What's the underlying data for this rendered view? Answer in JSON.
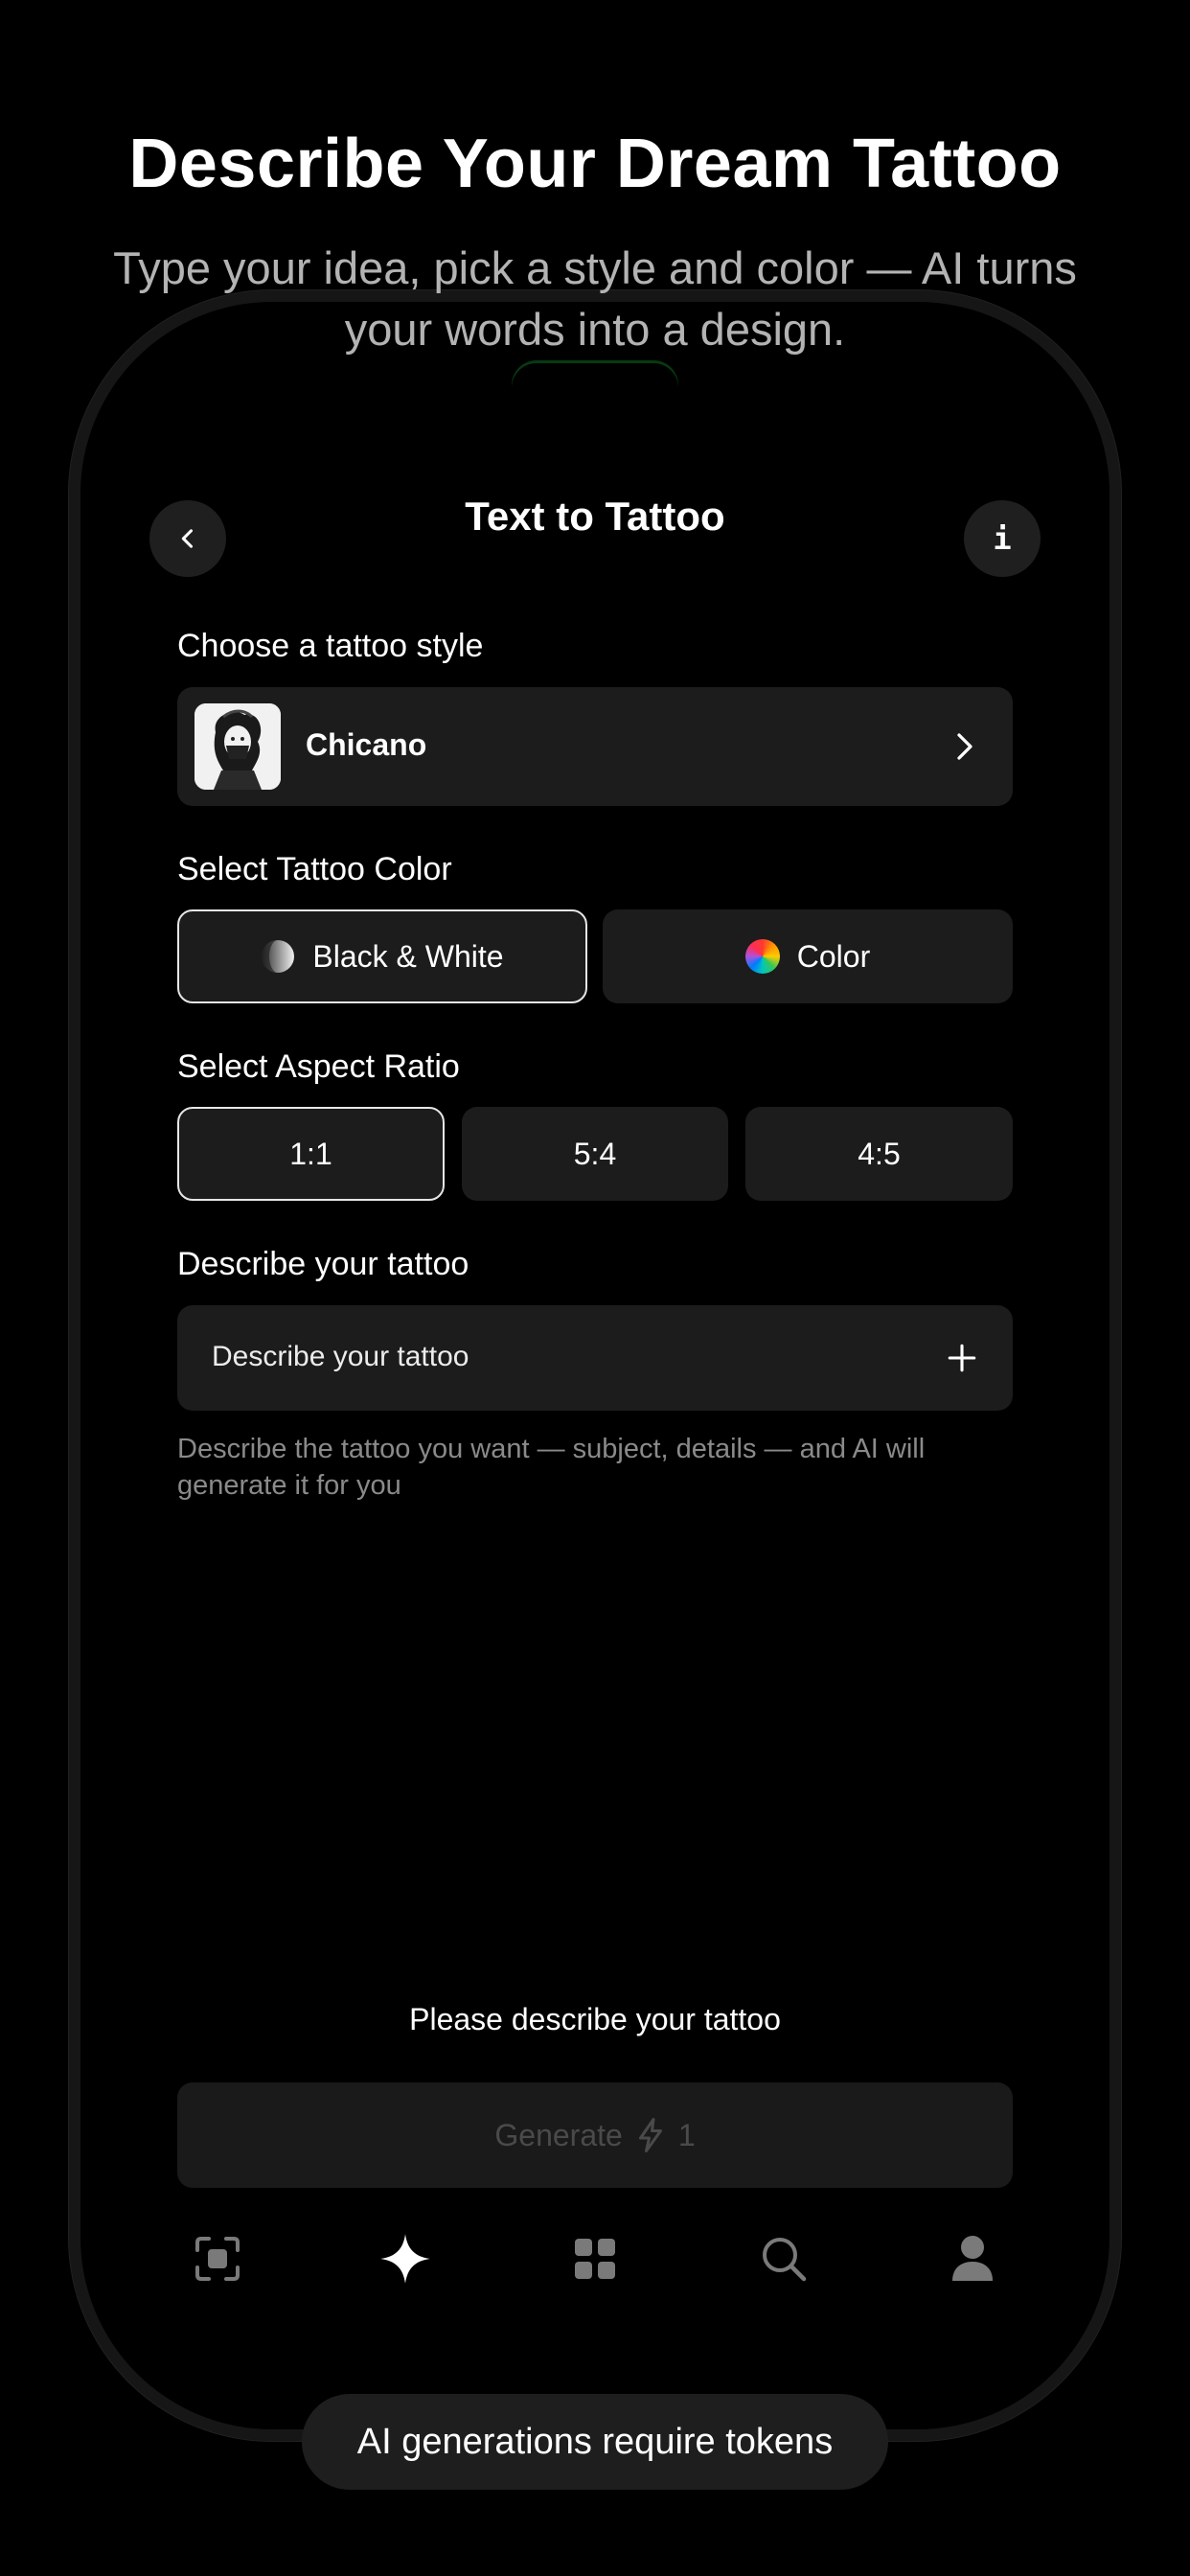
{
  "promo": {
    "headline": "Describe Your Dream Tattoo",
    "subline": "Type your idea, pick a style and color — AI turns your words into a design."
  },
  "header": {
    "title": "Text to Tattoo",
    "back_icon": "chevron-left-icon",
    "info_label": "i"
  },
  "style_section": {
    "label": "Choose a tattoo style",
    "selected_style": "Chicano",
    "thumbnail_icon": "chicano-woman-portrait",
    "chevron_icon": "chevron-right-icon"
  },
  "color_section": {
    "label": "Select Tattoo Color",
    "options": [
      {
        "label": "Black & White",
        "icon": "grayscale-circle-icon",
        "selected": true
      },
      {
        "label": "Color",
        "icon": "rainbow-circle-icon",
        "selected": false
      }
    ]
  },
  "aspect_section": {
    "label": "Select Aspect Ratio",
    "options": [
      {
        "label": "1:1",
        "selected": true
      },
      {
        "label": "5:4",
        "selected": false
      },
      {
        "label": "4:5",
        "selected": false
      }
    ]
  },
  "describe_section": {
    "label": "Describe your tattoo",
    "placeholder": "Describe your tattoo",
    "add_icon": "plus-icon",
    "hint": "Describe the tattoo you want — subject, details — and AI will generate it for you"
  },
  "status_message": "Please describe your tattoo",
  "generate": {
    "label": "Generate",
    "cost": "1",
    "icon": "lightning-icon",
    "enabled": false
  },
  "tab_bar": [
    {
      "name": "scan",
      "icon": "scan-icon",
      "active": false
    },
    {
      "name": "create",
      "icon": "sparkle-icon",
      "active": true
    },
    {
      "name": "gallery",
      "icon": "grid-icon",
      "active": false
    },
    {
      "name": "search",
      "icon": "search-icon",
      "active": false
    },
    {
      "name": "profile",
      "icon": "person-icon",
      "active": false
    }
  ],
  "toast": "AI generations require tokens",
  "colors": {
    "background": "#000000",
    "surface": "#1c1c1c",
    "selected_border": "#e6e6e6",
    "muted_text": "#8a8a8a",
    "disabled_text": "#4a4a4a"
  }
}
